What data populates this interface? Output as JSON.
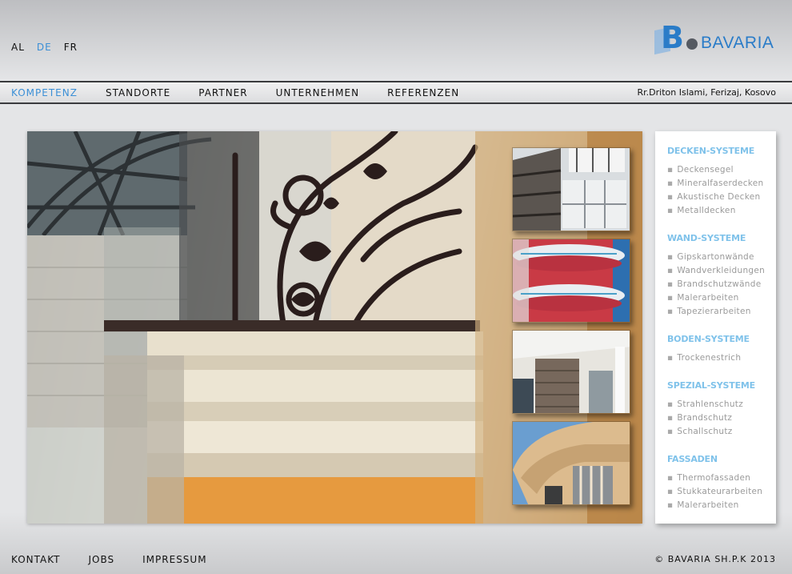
{
  "languages": [
    {
      "label": "AL",
      "active": false
    },
    {
      "label": "DE",
      "active": true
    },
    {
      "label": "FR",
      "active": false
    }
  ],
  "logo": {
    "letter": "B",
    "name": "BAVARIA"
  },
  "nav": {
    "items": [
      "KOMPETENZ",
      "STANDORTE",
      "PARTNER",
      "UNTERNEHMEN",
      "REFERENZEN"
    ],
    "address": "Rr.Driton Islami, Ferizaj, Kosovo"
  },
  "sidebar": {
    "sections": [
      {
        "title": "DECKEN-SYSTEME",
        "items": [
          "Deckensegel",
          "Mineralfaserdecken",
          "Akustische Decken",
          "Metalldecken"
        ]
      },
      {
        "title": "WAND-SYSTEME",
        "items": [
          "Gipskartonwände",
          "Wandverkleidungen",
          "Brandschutzwände",
          "Malerarbeiten",
          "Tapezierarbeiten"
        ]
      },
      {
        "title": "BODEN-SYSTEME",
        "items": [
          "Trockenestrich"
        ]
      },
      {
        "title": "SPEZIAL-SYSTEME",
        "items": [
          "Strahlenschutz",
          "Brandschutz",
          "Schallschutz"
        ]
      },
      {
        "title": "FASSADEN",
        "items": [
          "Thermofassaden",
          "Stukkateurarbeiten",
          "Malerarbeiten"
        ]
      }
    ]
  },
  "footer": {
    "links": [
      "KONTAKT",
      "JOBS",
      "IMPRESSUM"
    ],
    "copyright": "© BAVARIA SH.P.K  2013"
  },
  "colors": {
    "accent": "#3b8fd6",
    "sidebar_heading": "#7fc2ea",
    "nav_border": "#3a3b3e"
  }
}
